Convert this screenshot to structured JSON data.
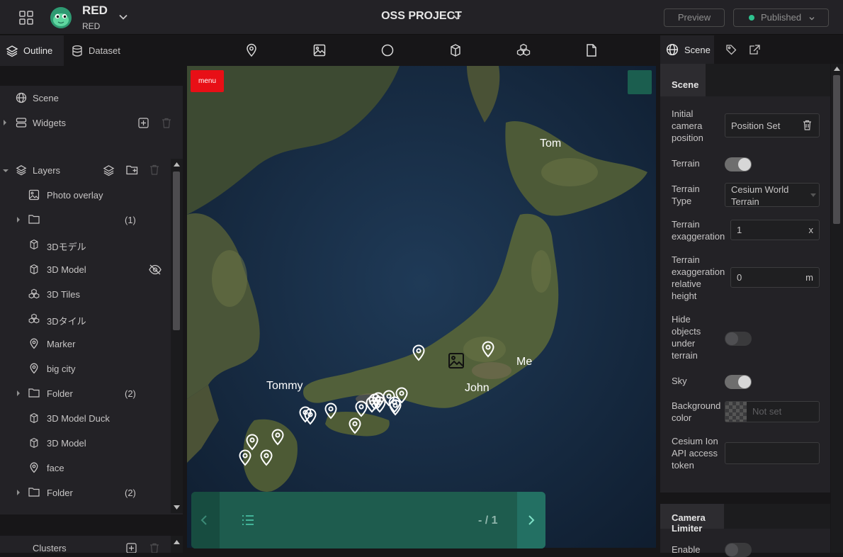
{
  "header": {
    "workspace_name": "RED",
    "workspace_sub": "RED",
    "project_title": "OSS PROJECT",
    "preview_label": "Preview",
    "publish_label": "Published",
    "publish_status_color": "#2ec28f"
  },
  "left_tabs": [
    {
      "label": "Outline",
      "icon": "layers-icon",
      "active": true
    },
    {
      "label": "Dataset",
      "icon": "database-icon",
      "active": false
    }
  ],
  "scene_section": {
    "scene_label": "Scene",
    "widgets_label": "Widgets"
  },
  "layers_section": {
    "title": "Layers",
    "items": [
      {
        "label": "Photo overlay",
        "icon": "image-icon",
        "caret": false,
        "count": ""
      },
      {
        "label": "",
        "icon": "folder-icon",
        "caret": true,
        "count": "(1)"
      },
      {
        "label": "3Dモデル",
        "icon": "cube-icon",
        "caret": false,
        "count": ""
      },
      {
        "label": "3D Model",
        "icon": "cube-icon",
        "caret": false,
        "count": "",
        "hidden": true
      },
      {
        "label": "3D Tiles",
        "icon": "tiles-icon",
        "caret": false,
        "count": ""
      },
      {
        "label": "3Dタイル",
        "icon": "tiles-icon",
        "caret": false,
        "count": ""
      },
      {
        "label": "Marker",
        "icon": "marker-icon",
        "caret": false,
        "count": ""
      },
      {
        "label": "big city",
        "icon": "marker-icon",
        "caret": false,
        "count": ""
      },
      {
        "label": "Folder",
        "icon": "folder-icon",
        "caret": true,
        "count": "(2)"
      },
      {
        "label": "3D Model Duck",
        "icon": "cube-icon",
        "caret": false,
        "count": ""
      },
      {
        "label": "3D Model",
        "icon": "cube-icon",
        "caret": false,
        "count": ""
      },
      {
        "label": "face",
        "icon": "marker-icon",
        "caret": false,
        "count": ""
      },
      {
        "label": "Folder",
        "icon": "folder-icon",
        "caret": true,
        "count": "(2)"
      }
    ]
  },
  "clusters_label": "Clusters",
  "toolbar_tools": [
    "marker-tool-icon",
    "image-tool-icon",
    "sphere-tool-icon",
    "model-tool-icon",
    "tileset-tool-icon",
    "file-tool-icon"
  ],
  "map": {
    "menu_label": "menu",
    "labels": [
      "Tom",
      "Tommy",
      "Me",
      "John"
    ],
    "pager": "- / 1"
  },
  "right_tabs": [
    {
      "label": "Scene",
      "icon": "globe-icon",
      "active": true
    },
    {
      "label": "",
      "icon": "tag-icon",
      "active": false
    },
    {
      "label": "",
      "icon": "export-icon",
      "active": false
    }
  ],
  "scene_props": {
    "section_title": "Scene",
    "initial_camera_label": "Initial camera position",
    "initial_camera_value": "Position Set",
    "terrain_label": "Terrain",
    "terrain_on": true,
    "terrain_type_label": "Terrain Type",
    "terrain_type_value": "Cesium World Terrain",
    "terrain_exag_label": "Terrain exaggeration",
    "terrain_exag_value": "1",
    "terrain_exag_unit": "x",
    "terrain_rel_label": "Terrain exaggeration relative height",
    "terrain_rel_value": "0",
    "terrain_rel_unit": "m",
    "hide_objects_label": "Hide objects under terrain",
    "hide_objects_on": false,
    "sky_label": "Sky",
    "sky_on": true,
    "bg_color_label": "Background color",
    "bg_color_value": "Not set",
    "ion_label": "Cesium Ion API access token",
    "ion_value": ""
  },
  "camera_limiter": {
    "title": "Camera Limiter",
    "enable_label": "Enable"
  }
}
